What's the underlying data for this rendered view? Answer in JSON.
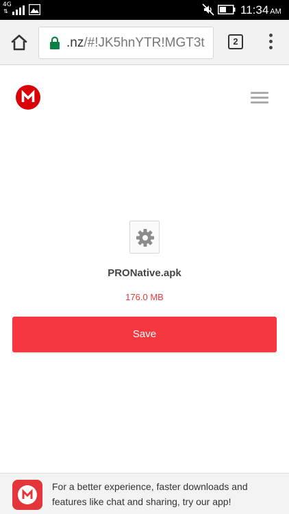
{
  "status_bar": {
    "network": "4G",
    "time": "11:34",
    "ampm": "AM",
    "icons": [
      "data-arrows-icon",
      "signal-icon",
      "gallery-icon",
      "mute-icon",
      "battery-icon"
    ]
  },
  "browser": {
    "url_main": ".nz",
    "url_rest": "/#!JK5hnYTR!MGT3t",
    "tab_count": "2",
    "icons": [
      "home-icon",
      "lock-icon",
      "tab-switcher-icon",
      "more-vert-icon"
    ]
  },
  "page": {
    "logo_letter": "M",
    "file_name": "PRONative.apk",
    "file_size": "176.0 MB",
    "save_label": "Save",
    "icons": [
      "mega-logo-icon",
      "hamburger-menu-icon",
      "gear-icon"
    ]
  },
  "app_banner": {
    "text": "For a better experience, faster downloads and features like chat and sharing, try our app!",
    "logo_letter": "M"
  },
  "colors": {
    "accent": "#f5383f",
    "brand_red": "#d90007",
    "size_text": "#e2393f",
    "status_bar": "#000000"
  }
}
